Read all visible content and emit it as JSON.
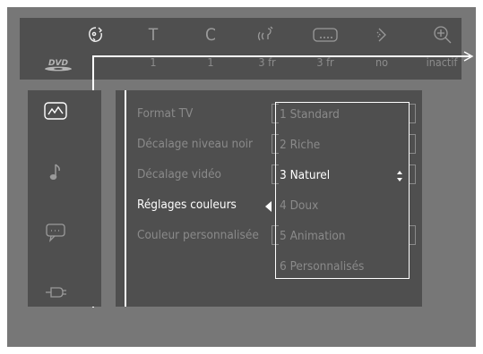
{
  "top_bar": {
    "icons": [
      {
        "name": "video-setup-icon",
        "active": true
      },
      {
        "name": "title-icon",
        "label": "T",
        "active": false
      },
      {
        "name": "chapter-icon",
        "label": "C",
        "active": false
      },
      {
        "name": "audio-language-icon",
        "active": false
      },
      {
        "name": "subtitle-icon",
        "active": false
      },
      {
        "name": "angle-icon",
        "active": false
      },
      {
        "name": "zoom-icon",
        "active": false
      }
    ],
    "values": [
      "1",
      "1",
      "3 fr",
      "3 fr",
      "no",
      "inactif"
    ],
    "source_logo": "DVD"
  },
  "side_menu": {
    "icons": [
      "picture-icon",
      "music-note-icon",
      "speech-bubble-icon",
      "plug-icon"
    ],
    "active": "picture-icon"
  },
  "main_menu": {
    "items": [
      "Format TV",
      "Décalage niveau noir",
      "Décalage vidéo",
      "Réglages couleurs",
      "Couleur personnalisée"
    ],
    "selected_index": 3
  },
  "submenu": {
    "items": [
      "1 Standard",
      "2 Riche",
      "3 Naturel",
      "4 Doux",
      "5 Animation",
      "6 Personnalisés"
    ],
    "selected_index": 2
  },
  "colors": {
    "background": "#777777",
    "panel": "#4f4f4f",
    "active_text": "#ffffff",
    "inactive_text": "#8a8a8a"
  }
}
